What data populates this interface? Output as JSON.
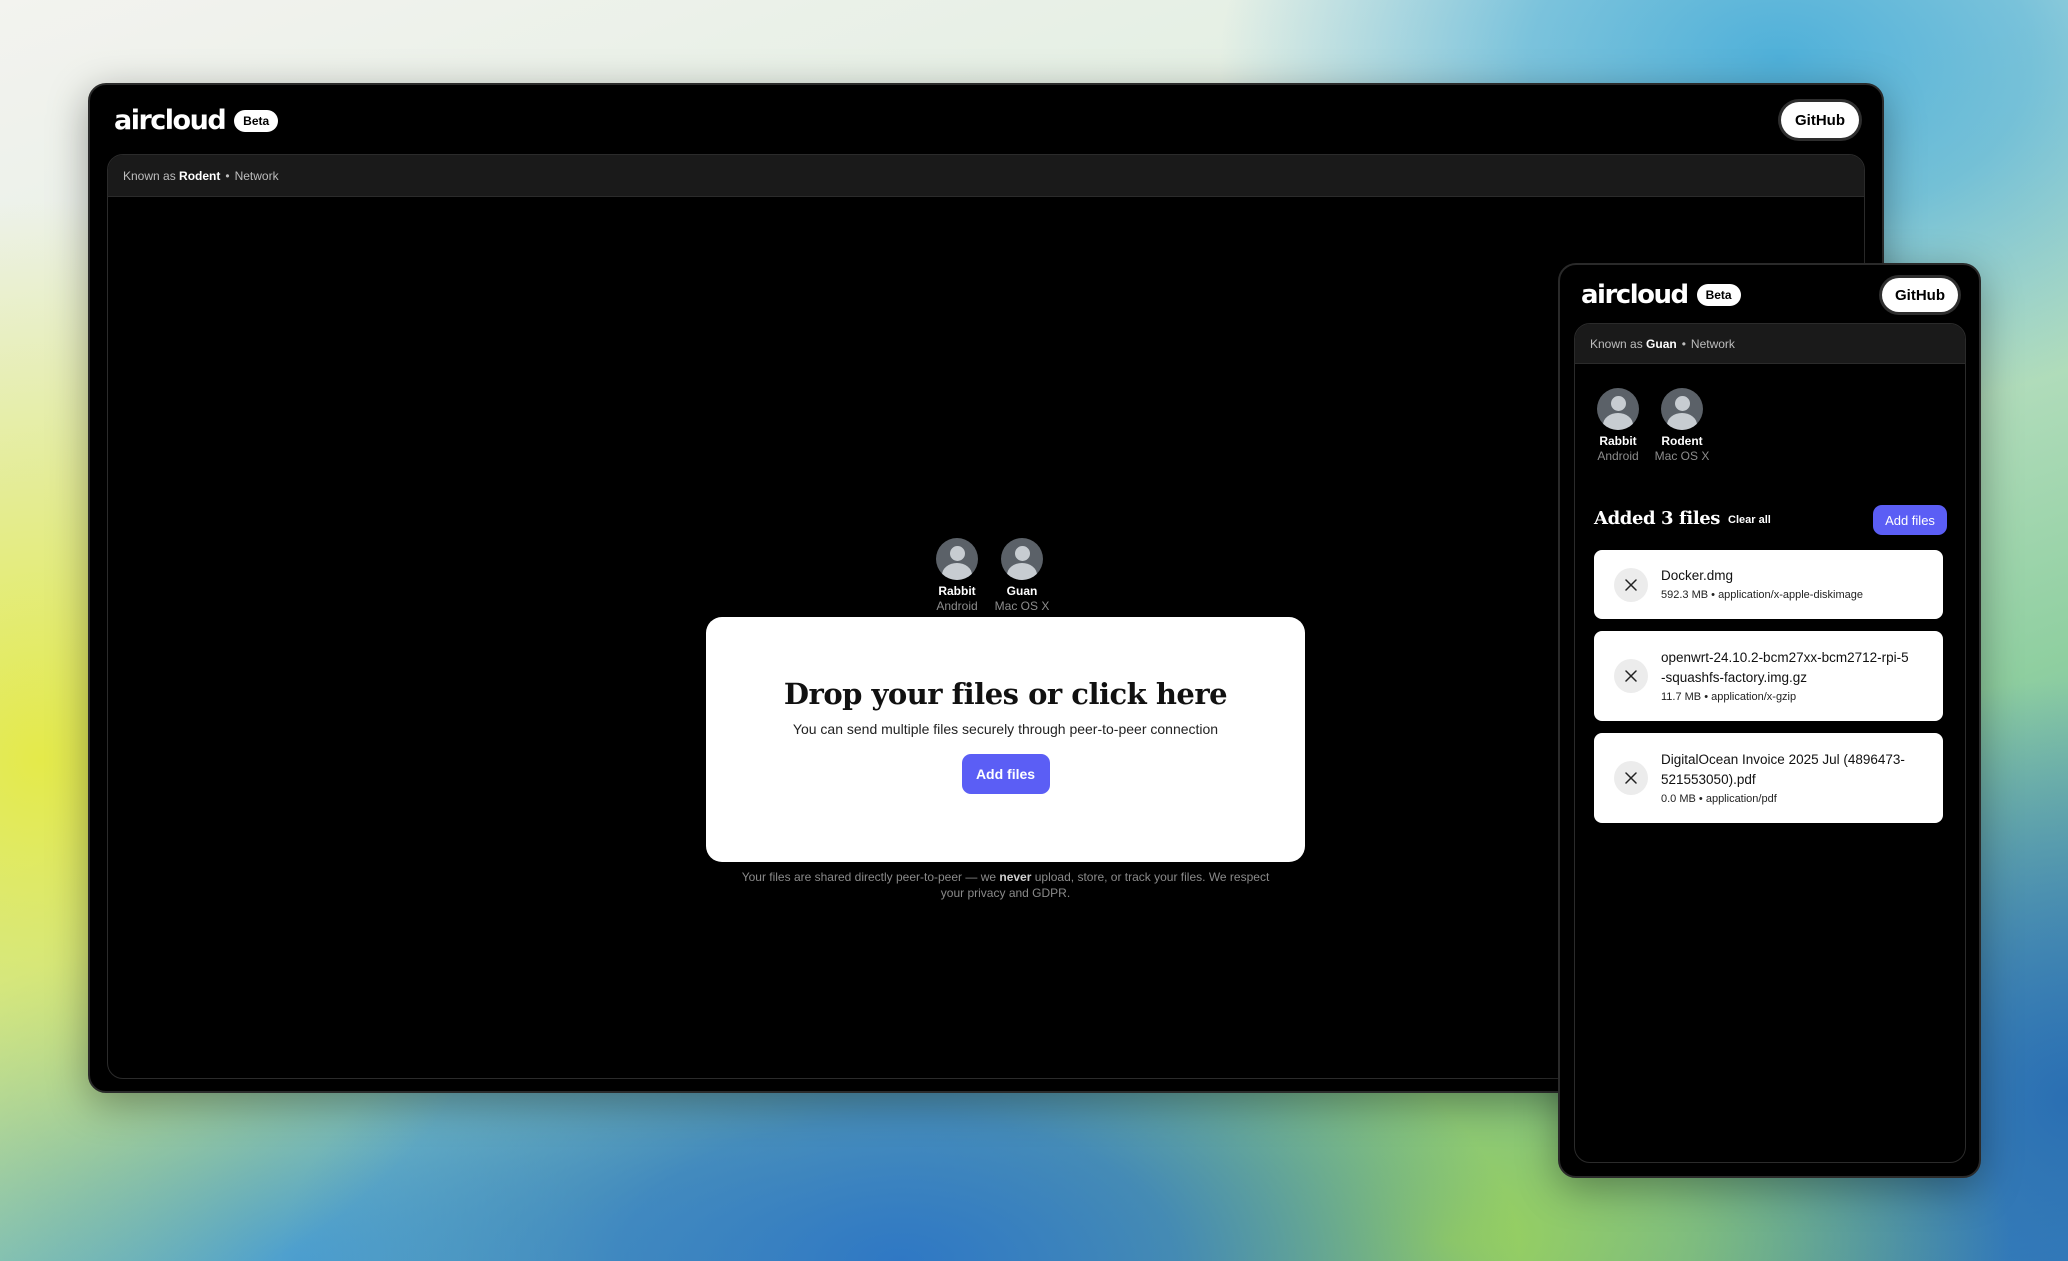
{
  "desktop": {
    "logo_text": "aircloud",
    "beta_label": "Beta",
    "github_label": "GitHub",
    "known_as_prefix": "Known as",
    "known_as_name": "Rodent",
    "separator": "•",
    "network_label": "Network",
    "peers": [
      {
        "name": "Rabbit",
        "os": "Android"
      },
      {
        "name": "Guan",
        "os": "Mac OS X"
      }
    ],
    "drop_title": "Drop your files or click here",
    "drop_subtitle": "You can send multiple files securely through peer-to-peer connection",
    "add_files_label": "Add files",
    "privacy_before": "Your files are shared directly peer-to-peer — we ",
    "privacy_bold": "never",
    "privacy_after": " upload, store, or track your files. We respect your privacy and GDPR."
  },
  "mobile": {
    "logo_text": "aircloud",
    "beta_label": "Beta",
    "github_label": "GitHub",
    "known_as_prefix": "Known as",
    "known_as_name": "Guan",
    "separator": "•",
    "network_label": "Network",
    "peers": [
      {
        "name": "Rabbit",
        "os": "Android"
      },
      {
        "name": "Rodent",
        "os": "Mac OS X"
      }
    ],
    "list_title": "Added 3 files",
    "clear_all_label": "Clear all",
    "add_files_label": "Add files",
    "files": [
      {
        "name": "Docker.dmg",
        "size": "592.3 MB",
        "type": "application/x-apple-diskimage"
      },
      {
        "name": "openwrt-24.10.2-bcm27xx-bcm2712-rpi-5-squashfs-factory.img.gz",
        "size": "11.7 MB",
        "type": "application/x-gzip"
      },
      {
        "name": "DigitalOcean Invoice 2025 Jul (4896473-521553050).pdf",
        "size": "0.0 MB",
        "type": "application/pdf"
      }
    ]
  },
  "colors": {
    "accent": "#5b5ef5",
    "window_bg": "#000000",
    "panel_bar_bg": "#1a1a1a"
  },
  "icons": [
    "avatar-icon",
    "close-icon"
  ]
}
